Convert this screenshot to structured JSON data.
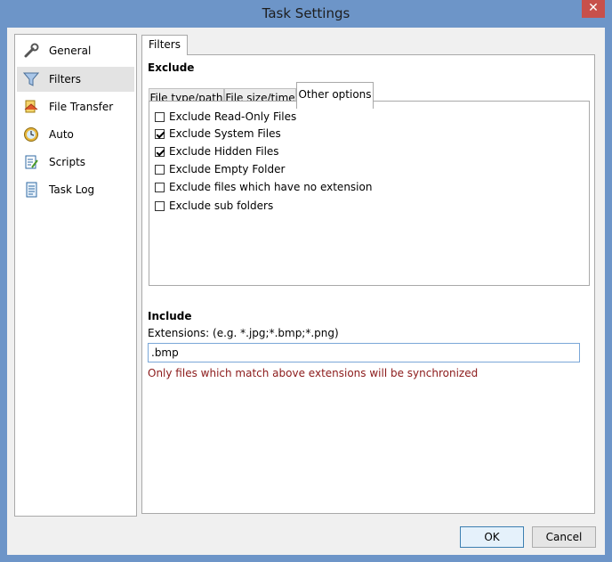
{
  "window": {
    "title": "Task Settings",
    "close_symbol": "✕"
  },
  "sidebar": {
    "items": [
      {
        "label": "General",
        "icon": "wrench-icon",
        "selected": false
      },
      {
        "label": "Filters",
        "icon": "funnel-icon",
        "selected": true
      },
      {
        "label": "File Transfer",
        "icon": "file-transfer-icon",
        "selected": false
      },
      {
        "label": "Auto",
        "icon": "clock-icon",
        "selected": false
      },
      {
        "label": "Scripts",
        "icon": "script-icon",
        "selected": false
      },
      {
        "label": "Task Log",
        "icon": "log-icon",
        "selected": false
      }
    ]
  },
  "main": {
    "tab_label": "Filters",
    "exclude": {
      "title": "Exclude",
      "tabs": [
        {
          "label": "File type/path",
          "active": false
        },
        {
          "label": "File size/time",
          "active": false
        },
        {
          "label": "Other options",
          "active": true
        }
      ],
      "options": [
        {
          "label": "Exclude Read-Only Files",
          "checked": false
        },
        {
          "label": "Exclude System Files",
          "checked": true
        },
        {
          "label": "Exclude Hidden Files",
          "checked": true
        },
        {
          "label": "Exclude Empty Folder",
          "checked": false
        },
        {
          "label": "Exclude files which have no extension",
          "checked": false
        },
        {
          "label": "Exclude sub folders",
          "checked": false
        }
      ]
    },
    "include": {
      "title": "Include",
      "extensions_label": "Extensions: (e.g. *.jpg;*.bmp;*.png)",
      "extensions_value": ".bmp",
      "hint": "Only files which match above extensions will be synchronized"
    }
  },
  "buttons": {
    "ok": "OK",
    "cancel": "Cancel"
  },
  "colors": {
    "titlebar": "#6d95c8",
    "close": "#c7504b",
    "hint": "#8b1a1a",
    "selected_nav": "#e3e3e3"
  }
}
